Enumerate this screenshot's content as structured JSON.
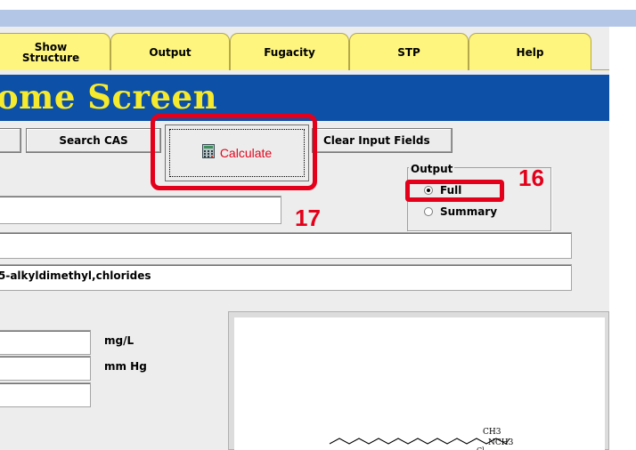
{
  "tabs": [
    {
      "line1": "Show",
      "line2": "Structure"
    },
    {
      "line1": "Output",
      "line2": ""
    },
    {
      "line1": "Fugacity",
      "line2": ""
    },
    {
      "line1": "STP",
      "line2": ""
    },
    {
      "line1": "Help",
      "line2": ""
    }
  ],
  "banner": {
    "title": "ome Screen"
  },
  "toolbar": {
    "search_cas_label": "Search CAS",
    "calculate_label": "Calculate",
    "clear_label": "Clear Input Fields"
  },
  "output_group": {
    "legend": "Output",
    "options": [
      {
        "label": "Full",
        "selected": true
      },
      {
        "label": "Summary",
        "selected": false
      }
    ]
  },
  "annotations": {
    "callout_output": "16",
    "callout_calculate": "17"
  },
  "fields": {
    "name_value": "5-alkyldimethyl,chlorides",
    "units": [
      "mg/L",
      "mm Hg"
    ]
  },
  "structure": {
    "atom_labels": {
      "ch3_top": "CH3",
      "n_ch3": "NCH3",
      "cl": "Cl"
    }
  },
  "colors": {
    "highlight": "#e4001a",
    "banner": "#0c50a7",
    "banner_text": "#f5ea2e",
    "tab": "#fdf57d"
  }
}
